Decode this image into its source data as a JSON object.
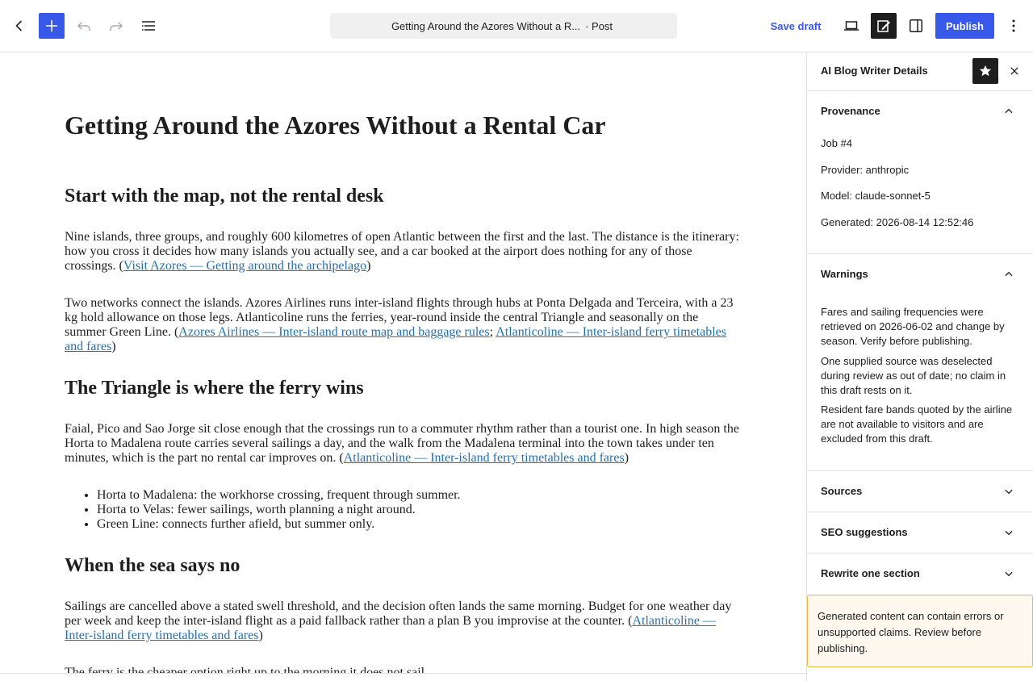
{
  "toolbar": {
    "back_icon": "chevron-left-icon",
    "add_icon": "plus-icon",
    "undo_icon": "undo-icon",
    "redo_icon": "redo-icon",
    "list_view_icon": "list-view-icon",
    "doc_title": "Getting Around the Azores Without a R...",
    "doc_type": "· Post",
    "save_draft": "Save draft",
    "preview_icon": "laptop-icon",
    "edit_icon": "edit-icon",
    "settings_icon": "sidebar-icon",
    "publish": "Publish",
    "options_icon": "more-vertical-icon",
    "accent_color": "#3858e9"
  },
  "post": {
    "title": "Getting Around the Azores Without a Rental Car",
    "h_map": "Start with the map, not the rental desk",
    "p1_text": "Nine islands, three groups, and roughly 600 kilometres of open Atlantic between the first and the last. The distance is the itinerary: how you cross it decides how many islands you actually see, and a car booked at the airport does nothing for any of those crossings. (",
    "p1_link": "Visit Azores — Getting around the archipelago",
    "p1_end": ")",
    "p2_text": "Two networks connect the islands. Azores Airlines runs inter-island flights through hubs at Ponta Delgada and Terceira, with a 23 kg hold allowance on those legs. Atlanticoline runs the ferries, year-round inside the central Triangle and seasonally on the summer Green Line. (",
    "p2_link1": "Azores Airlines — Inter-island route map and baggage rules",
    "p2_sep": "; ",
    "p2_link2": "Atlanticoline — Inter-island ferry timetables and fares",
    "p2_end": ")",
    "h_triangle": "The Triangle is where the ferry wins",
    "p3_text": "Faial, Pico and Sao Jorge sit close enough that the crossings run to a commuter rhythm rather than a tourist one. In high season the Horta to Madalena route carries several sailings a day, and the walk from the Madalena terminal into the town takes under ten minutes, which is the part no rental car improves on. (",
    "p3_link": "Atlanticoline — Inter-island ferry timetables and fares",
    "p3_end": ")",
    "bullets": [
      "Horta to Madalena: the workhorse crossing, frequent through summer.",
      "Horta to Velas: fewer sailings, worth planning a night around.",
      "Green Line: connects further afield, but summer only."
    ],
    "h_sea": "When the sea says no",
    "p4_text": "Sailings are cancelled above a stated swell threshold, and the decision often lands the same morning. Budget for one weather day per week and keep the inter-island flight as a paid fallback rather than a plan B you improvise at the counter. (",
    "p4_link": "Atlanticoline — Inter-island ferry timetables and fares",
    "p4_end": ")",
    "p5_text": "The ferry is the cheaper option right up to the morning it does not sail."
  },
  "sidebar": {
    "title": "AI Blog Writer Details",
    "star_icon": "star-icon",
    "close_icon": "close-icon",
    "provenance": {
      "label": "Provenance",
      "job": "Job #4",
      "provider": "Provider: anthropic",
      "model": "Model: claude-sonnet-5",
      "generated": "Generated: 2026-08-14 12:52:46"
    },
    "warnings": {
      "label": "Warnings",
      "items": [
        "Fares and sailing frequencies were retrieved on 2026-06-02 and change by season. Verify before publishing.",
        "One supplied source was deselected during review as out of date; no claim in this draft rests on it.",
        "Resident fare bands quoted by the airline are not available to visitors and are excluded from this draft."
      ]
    },
    "sources_label": "Sources",
    "seo_label": "SEO suggestions",
    "rewrite_label": "Rewrite one section",
    "notice": "Generated content can contain errors or unsupported claims. Review before publishing."
  }
}
